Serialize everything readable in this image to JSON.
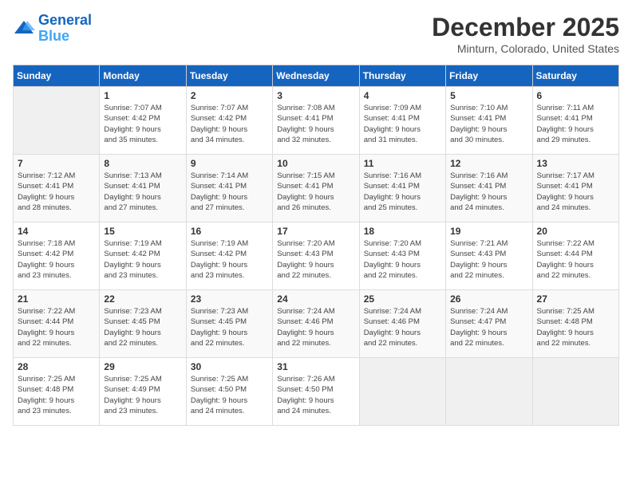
{
  "logo": {
    "line1": "General",
    "line2": "Blue"
  },
  "title": "December 2025",
  "subtitle": "Minturn, Colorado, United States",
  "days_of_week": [
    "Sunday",
    "Monday",
    "Tuesday",
    "Wednesday",
    "Thursday",
    "Friday",
    "Saturday"
  ],
  "weeks": [
    [
      {
        "num": "",
        "info": ""
      },
      {
        "num": "1",
        "info": "Sunrise: 7:07 AM\nSunset: 4:42 PM\nDaylight: 9 hours\nand 35 minutes."
      },
      {
        "num": "2",
        "info": "Sunrise: 7:07 AM\nSunset: 4:42 PM\nDaylight: 9 hours\nand 34 minutes."
      },
      {
        "num": "3",
        "info": "Sunrise: 7:08 AM\nSunset: 4:41 PM\nDaylight: 9 hours\nand 32 minutes."
      },
      {
        "num": "4",
        "info": "Sunrise: 7:09 AM\nSunset: 4:41 PM\nDaylight: 9 hours\nand 31 minutes."
      },
      {
        "num": "5",
        "info": "Sunrise: 7:10 AM\nSunset: 4:41 PM\nDaylight: 9 hours\nand 30 minutes."
      },
      {
        "num": "6",
        "info": "Sunrise: 7:11 AM\nSunset: 4:41 PM\nDaylight: 9 hours\nand 29 minutes."
      }
    ],
    [
      {
        "num": "7",
        "info": "Sunrise: 7:12 AM\nSunset: 4:41 PM\nDaylight: 9 hours\nand 28 minutes."
      },
      {
        "num": "8",
        "info": "Sunrise: 7:13 AM\nSunset: 4:41 PM\nDaylight: 9 hours\nand 27 minutes."
      },
      {
        "num": "9",
        "info": "Sunrise: 7:14 AM\nSunset: 4:41 PM\nDaylight: 9 hours\nand 27 minutes."
      },
      {
        "num": "10",
        "info": "Sunrise: 7:15 AM\nSunset: 4:41 PM\nDaylight: 9 hours\nand 26 minutes."
      },
      {
        "num": "11",
        "info": "Sunrise: 7:16 AM\nSunset: 4:41 PM\nDaylight: 9 hours\nand 25 minutes."
      },
      {
        "num": "12",
        "info": "Sunrise: 7:16 AM\nSunset: 4:41 PM\nDaylight: 9 hours\nand 24 minutes."
      },
      {
        "num": "13",
        "info": "Sunrise: 7:17 AM\nSunset: 4:41 PM\nDaylight: 9 hours\nand 24 minutes."
      }
    ],
    [
      {
        "num": "14",
        "info": "Sunrise: 7:18 AM\nSunset: 4:42 PM\nDaylight: 9 hours\nand 23 minutes."
      },
      {
        "num": "15",
        "info": "Sunrise: 7:19 AM\nSunset: 4:42 PM\nDaylight: 9 hours\nand 23 minutes."
      },
      {
        "num": "16",
        "info": "Sunrise: 7:19 AM\nSunset: 4:42 PM\nDaylight: 9 hours\nand 23 minutes."
      },
      {
        "num": "17",
        "info": "Sunrise: 7:20 AM\nSunset: 4:43 PM\nDaylight: 9 hours\nand 22 minutes."
      },
      {
        "num": "18",
        "info": "Sunrise: 7:20 AM\nSunset: 4:43 PM\nDaylight: 9 hours\nand 22 minutes."
      },
      {
        "num": "19",
        "info": "Sunrise: 7:21 AM\nSunset: 4:43 PM\nDaylight: 9 hours\nand 22 minutes."
      },
      {
        "num": "20",
        "info": "Sunrise: 7:22 AM\nSunset: 4:44 PM\nDaylight: 9 hours\nand 22 minutes."
      }
    ],
    [
      {
        "num": "21",
        "info": "Sunrise: 7:22 AM\nSunset: 4:44 PM\nDaylight: 9 hours\nand 22 minutes."
      },
      {
        "num": "22",
        "info": "Sunrise: 7:23 AM\nSunset: 4:45 PM\nDaylight: 9 hours\nand 22 minutes."
      },
      {
        "num": "23",
        "info": "Sunrise: 7:23 AM\nSunset: 4:45 PM\nDaylight: 9 hours\nand 22 minutes."
      },
      {
        "num": "24",
        "info": "Sunrise: 7:24 AM\nSunset: 4:46 PM\nDaylight: 9 hours\nand 22 minutes."
      },
      {
        "num": "25",
        "info": "Sunrise: 7:24 AM\nSunset: 4:46 PM\nDaylight: 9 hours\nand 22 minutes."
      },
      {
        "num": "26",
        "info": "Sunrise: 7:24 AM\nSunset: 4:47 PM\nDaylight: 9 hours\nand 22 minutes."
      },
      {
        "num": "27",
        "info": "Sunrise: 7:25 AM\nSunset: 4:48 PM\nDaylight: 9 hours\nand 22 minutes."
      }
    ],
    [
      {
        "num": "28",
        "info": "Sunrise: 7:25 AM\nSunset: 4:48 PM\nDaylight: 9 hours\nand 23 minutes."
      },
      {
        "num": "29",
        "info": "Sunrise: 7:25 AM\nSunset: 4:49 PM\nDaylight: 9 hours\nand 23 minutes."
      },
      {
        "num": "30",
        "info": "Sunrise: 7:25 AM\nSunset: 4:50 PM\nDaylight: 9 hours\nand 24 minutes."
      },
      {
        "num": "31",
        "info": "Sunrise: 7:26 AM\nSunset: 4:50 PM\nDaylight: 9 hours\nand 24 minutes."
      },
      {
        "num": "",
        "info": ""
      },
      {
        "num": "",
        "info": ""
      },
      {
        "num": "",
        "info": ""
      }
    ]
  ]
}
